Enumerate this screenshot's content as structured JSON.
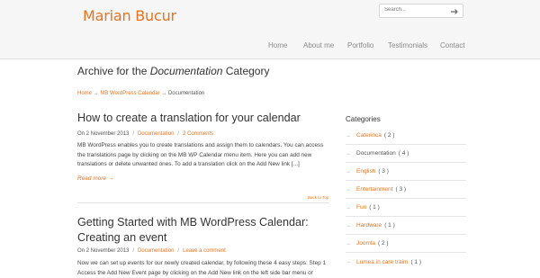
{
  "site": {
    "title": "Marian Bucur"
  },
  "search": {
    "placeholder": "Search..."
  },
  "nav": {
    "items": [
      "Home",
      "About me",
      "Portfolio",
      "Testimonials",
      "Contact"
    ]
  },
  "archive": {
    "prefix": "Archive for the",
    "category": "Documentation",
    "suffix": "Category"
  },
  "breadcrumb": {
    "home": "Home",
    "sep": "→",
    "parent": "MB WordPress Calendar",
    "current": "Documentation"
  },
  "posts": [
    {
      "title": "How to create a translation for your calendar",
      "date": "On 2 November 2013",
      "category": "Documentation",
      "comments": "2 Comments",
      "excerpt": "MB WordPress enables you to create translations and assign them to calendars. You can access the translations page by clicking on the MB WP Calendar menu item. Here you can add new translations or delete unwanted ones. To add a translation click on the Add New link [...]",
      "read_more": "Read more →",
      "back_to_top": "Back to Top"
    },
    {
      "title": "Getting Started with MB WordPress Calendar: Creating an event",
      "date": "On 2 November 2013",
      "category": "Documentation",
      "comments": "Leave a comment",
      "excerpt": "Now we can set up events for our newly created calendar, by following these 4 easy steps: Step 1 Access the Add New Event page by clicking on the Add New link on the left side bar menu or"
    }
  ],
  "sidebar": {
    "title": "Categories",
    "categories": [
      {
        "name": "Caterinca",
        "count": "( 2 )"
      },
      {
        "name": "Documentation",
        "count": "( 4 )"
      },
      {
        "name": "English",
        "count": "( 3 )"
      },
      {
        "name": "Entertainment",
        "count": "( 3 )"
      },
      {
        "name": "Fun",
        "count": "( 1 )"
      },
      {
        "name": "Hardware",
        "count": "( 1 )"
      },
      {
        "name": "Joomla",
        "count": "( 2 )"
      },
      {
        "name": "Lumea in care traim",
        "count": "( 1 )"
      }
    ]
  },
  "colors": {
    "accent": "#e8731e",
    "text": "#333333",
    "muted": "#8a8a8a",
    "band": "#f6f6f6"
  }
}
